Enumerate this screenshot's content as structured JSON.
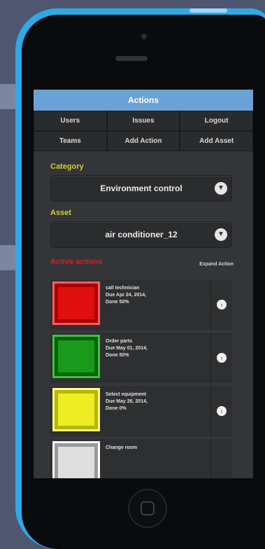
{
  "app": {
    "title": "Actions"
  },
  "nav": {
    "row1": [
      "Users",
      "Issues",
      "Logout"
    ],
    "row2": [
      "Teams",
      "Add Action",
      "Add Asset"
    ]
  },
  "category": {
    "label": "Category",
    "value": "Environment control"
  },
  "asset": {
    "label": "Asset",
    "value": "air conditioner_12"
  },
  "actions": {
    "label": "Active actions",
    "expand_label": "Expand Action",
    "items": [
      {
        "color": "#e01010",
        "title": "call technician",
        "due": "Due Apr 24, 2014,",
        "status": "Done 50%"
      },
      {
        "color": "#1a9a1a",
        "title": "Order parts",
        "due": "Due May 01, 2014,",
        "status": "Done 50%"
      },
      {
        "color": "#eded22",
        "title": "Select equipment",
        "due": "Due May 26, 2014,",
        "status": "Done 0%"
      },
      {
        "color": "#dedede",
        "title": "Change room",
        "due": "",
        "status": ""
      }
    ]
  },
  "icons": {
    "chevron": "chevron-down-icon",
    "arrow": "chevron-right-icon"
  }
}
